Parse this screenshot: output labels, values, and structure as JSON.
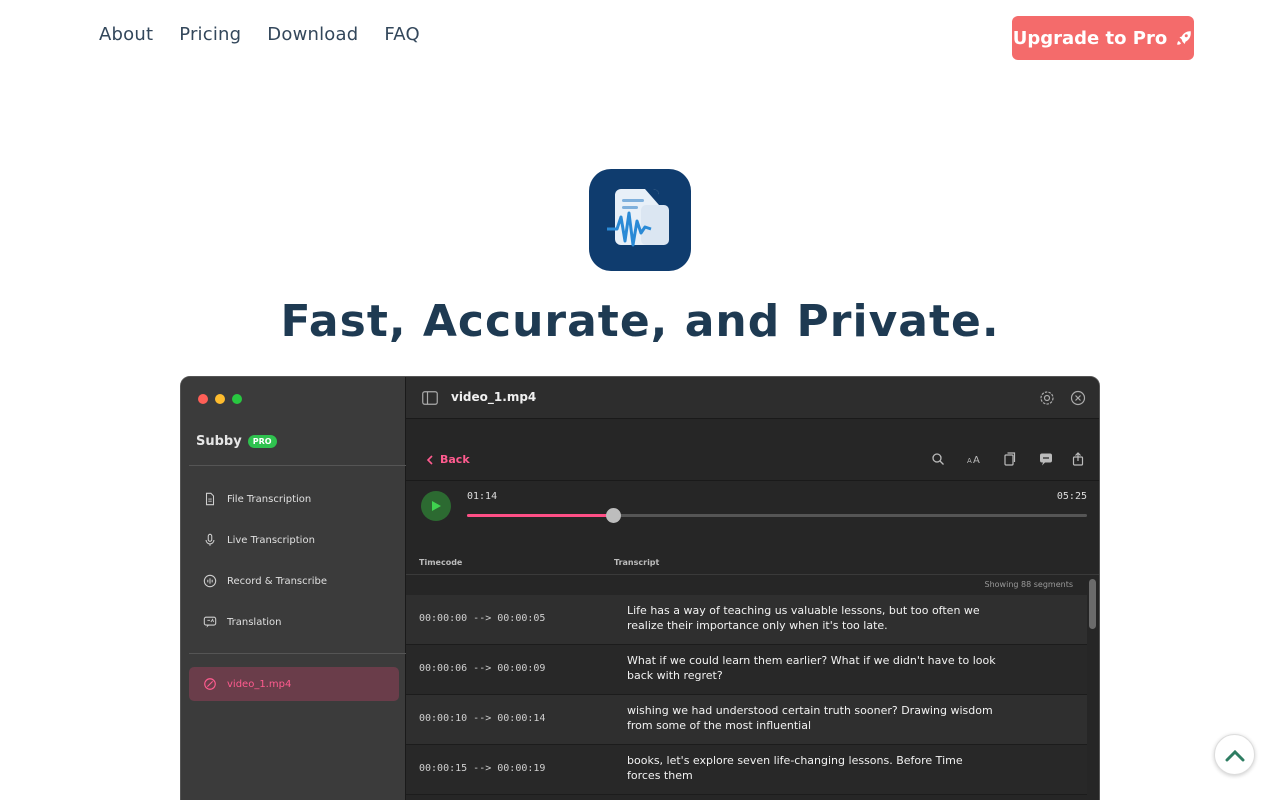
{
  "nav": {
    "links": [
      "About",
      "Pricing",
      "Download",
      "FAQ"
    ],
    "upgrade_label": "Upgrade to Pro"
  },
  "hero": {
    "title": "Fast, Accurate, and Private."
  },
  "app": {
    "brand": "Subby",
    "badge": "PRO",
    "sidebar": [
      {
        "label": "File Transcription",
        "icon": "document-icon"
      },
      {
        "label": "Live Transcription",
        "icon": "microphone-icon"
      },
      {
        "label": "Record & Transcribe",
        "icon": "record-icon"
      },
      {
        "label": "Translation",
        "icon": "translate-icon"
      }
    ],
    "active_file": "video_1.mp4",
    "window_title": "video_1.mp4",
    "back_label": "Back",
    "player": {
      "current": "01:14",
      "total": "05:25",
      "progress": 0.235
    },
    "table": {
      "col_timecode": "Timecode",
      "col_transcript": "Transcript",
      "segment_count": "Showing 88 segments",
      "rows": [
        {
          "timecode": "00:00:00 --> 00:00:05",
          "text": " Life has a way of teaching us valuable lessons, but too often we\nrealize their importance only when it's too late."
        },
        {
          "timecode": "00:00:06 --> 00:00:09",
          "text": " What if we could learn them earlier? What if we didn't have to look\nback with regret?"
        },
        {
          "timecode": "00:00:10 --> 00:00:14",
          "text": " wishing we had understood certain truth sooner? Drawing wisdom\nfrom some of the most influential"
        },
        {
          "timecode": "00:00:15 --> 00:00:19",
          "text": " books, let's explore seven life-changing lessons. Before Time\nforces them"
        }
      ]
    }
  },
  "colors": {
    "upgrade": "#f46b6b",
    "accent_pink": "#ff5b8f",
    "pro_green": "#2fc24f",
    "title": "#1e3a52"
  }
}
